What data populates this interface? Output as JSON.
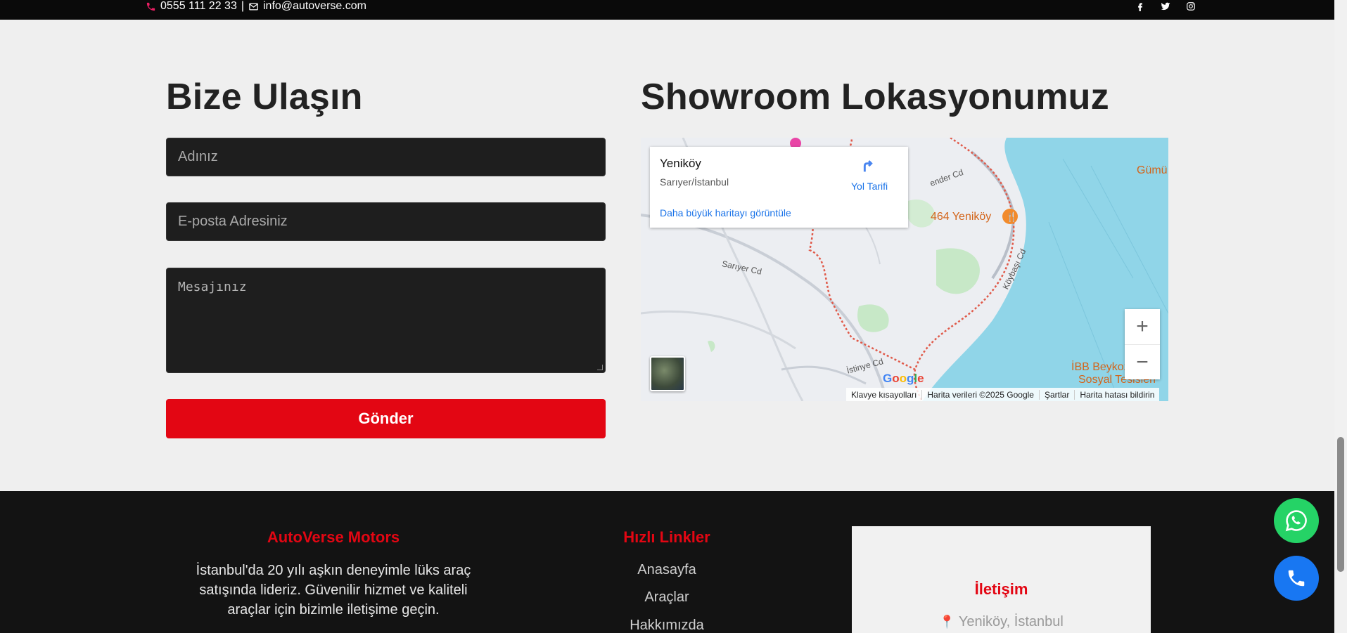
{
  "topbar": {
    "phone": "0555 111 22 33",
    "separator": "|",
    "email": "info@autoverse.com",
    "social_icons": [
      "facebook-icon",
      "twitter-icon",
      "instagram-icon"
    ]
  },
  "contact": {
    "heading": "Bize Ulaşın",
    "name_placeholder": "Adınız",
    "email_placeholder": "E-posta Adresiniz",
    "message_placeholder": "Mesajınız",
    "submit_label": "Gönder"
  },
  "map_section": {
    "heading": "Showroom Lokasyonumuz",
    "place_name": "Yeniköy",
    "place_address": "Sarıyer/İstanbul",
    "directions_label": "Yol Tarifi",
    "larger_map_link": "Daha büyük haritayı görüntüle",
    "labels": {
      "restaurant": "464 Yeniköy",
      "gumus": "Gümü",
      "ibb": "İBB Beykoz",
      "ibb2": "Sosyal Tesisleri",
      "sariyer_cd": "Sarıyer Cd",
      "koybasi_cd": "Köybaşı Cd",
      "istinye_cd": "İstinye Cd",
      "ender_cd": "ender Cd"
    },
    "google_logo": "Google",
    "attribution": [
      "Klavye kısayolları",
      "Harita verileri ©2025 Google",
      "Şartlar",
      "Harita hatası bildirin"
    ],
    "zoom_in": "+",
    "zoom_out": "−"
  },
  "footer": {
    "brand_title": "AutoVerse Motors",
    "about": "İstanbul'da 20 yılı aşkın deneyimle lüks araç satışında lideriz. Güvenilir hizmet ve kaliteli araçlar için bizimle iletişime geçin.",
    "links_title": "Hızlı Linkler",
    "links": [
      "Anasayfa",
      "Araçlar",
      "Hakkımızda"
    ],
    "contact_title": "İletişim",
    "contact_location": "Yeniköy, İstanbul"
  },
  "colors": {
    "accent": "#e30613",
    "whatsapp": "#25d366",
    "call": "#1877f2"
  }
}
